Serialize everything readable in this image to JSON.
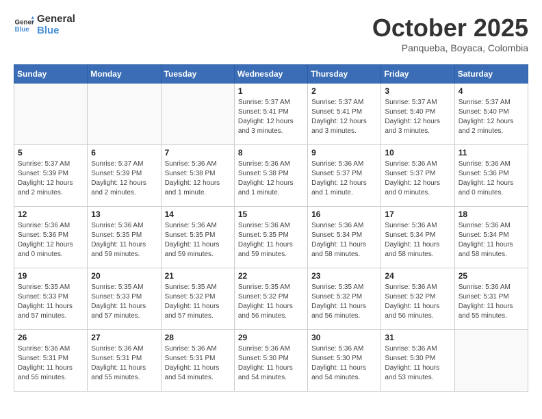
{
  "header": {
    "logo_general": "General",
    "logo_blue": "Blue",
    "month_title": "October 2025",
    "location": "Panqueba, Boyaca, Colombia"
  },
  "days_of_week": [
    "Sunday",
    "Monday",
    "Tuesday",
    "Wednesday",
    "Thursday",
    "Friday",
    "Saturday"
  ],
  "weeks": [
    [
      {
        "day": "",
        "info": ""
      },
      {
        "day": "",
        "info": ""
      },
      {
        "day": "",
        "info": ""
      },
      {
        "day": "1",
        "info": "Sunrise: 5:37 AM\nSunset: 5:41 PM\nDaylight: 12 hours and 3 minutes."
      },
      {
        "day": "2",
        "info": "Sunrise: 5:37 AM\nSunset: 5:41 PM\nDaylight: 12 hours and 3 minutes."
      },
      {
        "day": "3",
        "info": "Sunrise: 5:37 AM\nSunset: 5:40 PM\nDaylight: 12 hours and 3 minutes."
      },
      {
        "day": "4",
        "info": "Sunrise: 5:37 AM\nSunset: 5:40 PM\nDaylight: 12 hours and 2 minutes."
      }
    ],
    [
      {
        "day": "5",
        "info": "Sunrise: 5:37 AM\nSunset: 5:39 PM\nDaylight: 12 hours and 2 minutes."
      },
      {
        "day": "6",
        "info": "Sunrise: 5:37 AM\nSunset: 5:39 PM\nDaylight: 12 hours and 2 minutes."
      },
      {
        "day": "7",
        "info": "Sunrise: 5:36 AM\nSunset: 5:38 PM\nDaylight: 12 hours and 1 minute."
      },
      {
        "day": "8",
        "info": "Sunrise: 5:36 AM\nSunset: 5:38 PM\nDaylight: 12 hours and 1 minute."
      },
      {
        "day": "9",
        "info": "Sunrise: 5:36 AM\nSunset: 5:37 PM\nDaylight: 12 hours and 1 minute."
      },
      {
        "day": "10",
        "info": "Sunrise: 5:36 AM\nSunset: 5:37 PM\nDaylight: 12 hours and 0 minutes."
      },
      {
        "day": "11",
        "info": "Sunrise: 5:36 AM\nSunset: 5:36 PM\nDaylight: 12 hours and 0 minutes."
      }
    ],
    [
      {
        "day": "12",
        "info": "Sunrise: 5:36 AM\nSunset: 5:36 PM\nDaylight: 12 hours and 0 minutes."
      },
      {
        "day": "13",
        "info": "Sunrise: 5:36 AM\nSunset: 5:35 PM\nDaylight: 11 hours and 59 minutes."
      },
      {
        "day": "14",
        "info": "Sunrise: 5:36 AM\nSunset: 5:35 PM\nDaylight: 11 hours and 59 minutes."
      },
      {
        "day": "15",
        "info": "Sunrise: 5:36 AM\nSunset: 5:35 PM\nDaylight: 11 hours and 59 minutes."
      },
      {
        "day": "16",
        "info": "Sunrise: 5:36 AM\nSunset: 5:34 PM\nDaylight: 11 hours and 58 minutes."
      },
      {
        "day": "17",
        "info": "Sunrise: 5:36 AM\nSunset: 5:34 PM\nDaylight: 11 hours and 58 minutes."
      },
      {
        "day": "18",
        "info": "Sunrise: 5:36 AM\nSunset: 5:34 PM\nDaylight: 11 hours and 58 minutes."
      }
    ],
    [
      {
        "day": "19",
        "info": "Sunrise: 5:35 AM\nSunset: 5:33 PM\nDaylight: 11 hours and 57 minutes."
      },
      {
        "day": "20",
        "info": "Sunrise: 5:35 AM\nSunset: 5:33 PM\nDaylight: 11 hours and 57 minutes."
      },
      {
        "day": "21",
        "info": "Sunrise: 5:35 AM\nSunset: 5:32 PM\nDaylight: 11 hours and 57 minutes."
      },
      {
        "day": "22",
        "info": "Sunrise: 5:35 AM\nSunset: 5:32 PM\nDaylight: 11 hours and 56 minutes."
      },
      {
        "day": "23",
        "info": "Sunrise: 5:35 AM\nSunset: 5:32 PM\nDaylight: 11 hours and 56 minutes."
      },
      {
        "day": "24",
        "info": "Sunrise: 5:36 AM\nSunset: 5:32 PM\nDaylight: 11 hours and 56 minutes."
      },
      {
        "day": "25",
        "info": "Sunrise: 5:36 AM\nSunset: 5:31 PM\nDaylight: 11 hours and 55 minutes."
      }
    ],
    [
      {
        "day": "26",
        "info": "Sunrise: 5:36 AM\nSunset: 5:31 PM\nDaylight: 11 hours and 55 minutes."
      },
      {
        "day": "27",
        "info": "Sunrise: 5:36 AM\nSunset: 5:31 PM\nDaylight: 11 hours and 55 minutes."
      },
      {
        "day": "28",
        "info": "Sunrise: 5:36 AM\nSunset: 5:31 PM\nDaylight: 11 hours and 54 minutes."
      },
      {
        "day": "29",
        "info": "Sunrise: 5:36 AM\nSunset: 5:30 PM\nDaylight: 11 hours and 54 minutes."
      },
      {
        "day": "30",
        "info": "Sunrise: 5:36 AM\nSunset: 5:30 PM\nDaylight: 11 hours and 54 minutes."
      },
      {
        "day": "31",
        "info": "Sunrise: 5:36 AM\nSunset: 5:30 PM\nDaylight: 11 hours and 53 minutes."
      },
      {
        "day": "",
        "info": ""
      }
    ]
  ]
}
